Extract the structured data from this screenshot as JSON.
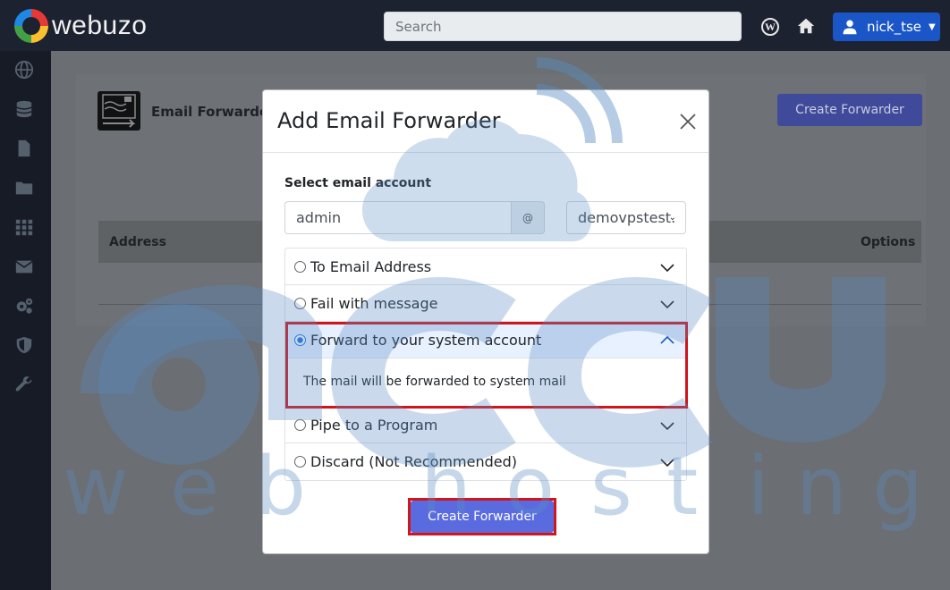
{
  "header": {
    "logo_text": "webuzo",
    "search_placeholder": "Search",
    "user_label": "nick_tse"
  },
  "sidebar": {
    "items": [
      "globe-icon",
      "database-icon",
      "file-icon",
      "folder-icon",
      "apps-icon",
      "mail-icon",
      "gears-icon",
      "shield-icon",
      "wrench-icon"
    ]
  },
  "background_page": {
    "title": "Email Forwarde",
    "create_button": "Create Forwarder",
    "table_headers": [
      "Address",
      "Options"
    ]
  },
  "modal": {
    "title": "Add Email Forwarder",
    "field_label": "Select email account",
    "local_part": "admin",
    "at_symbol": "@",
    "domain": "demovpstest.",
    "options": [
      {
        "label": "To Email Address",
        "selected": false
      },
      {
        "label": "Fail with message",
        "selected": false
      },
      {
        "label": "Forward to your system account",
        "selected": true,
        "description": "The mail will be forwarded to system mail"
      },
      {
        "label": "Pipe to a Program",
        "selected": false
      },
      {
        "label": "Discard (Not Recommended)",
        "selected": false
      }
    ],
    "submit_label": "Create Forwarder"
  },
  "colors": {
    "topbar": "#1d2230",
    "sidebar": "#171b26",
    "user_button": "#1a56c7",
    "primary": "#5a6be0",
    "highlight": "#d0161c"
  }
}
